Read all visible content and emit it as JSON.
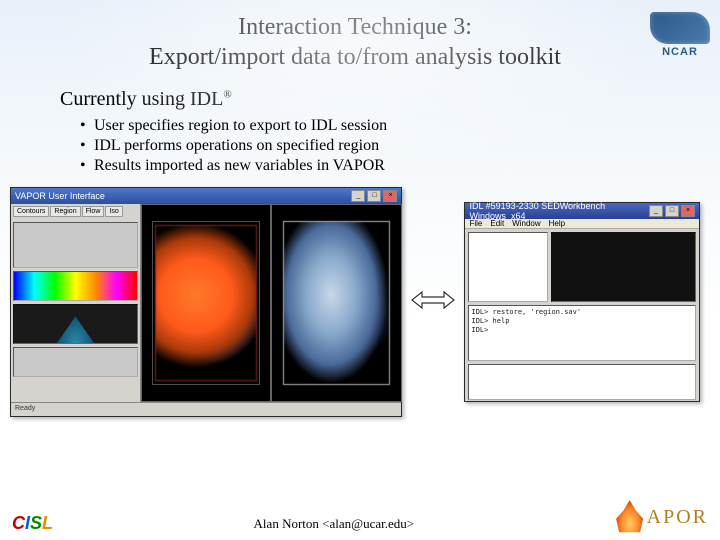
{
  "title": {
    "line1": "Interaction Technique 3:",
    "line2": "Export/import data to/from analysis toolkit"
  },
  "subheading": "Currently using IDL",
  "subheading_mark": "®",
  "bullets": [
    "User specifies region to export to IDL session",
    "IDL performs operations on specified region",
    "Results imported as new variables in VAPOR"
  ],
  "vapor_app": {
    "title": "VAPOR User Interface",
    "tabs": [
      "Contours",
      "Region",
      "Flow",
      "Iso"
    ],
    "status": "Ready"
  },
  "idl_app": {
    "title": "IDL #59193-2330  SEDWorkbench Windows_x64",
    "menu": [
      "File",
      "Edit",
      "Window",
      "Help"
    ],
    "console_prompt": "IDL>",
    "console_lines": [
      "IDL> restore, 'region.sav'",
      "IDL> help",
      "IDL> "
    ]
  },
  "footer": {
    "author": "Alan Norton <alan@ucar.edu>"
  },
  "logos": {
    "ncar": "NCAR",
    "cisl": "CISL",
    "vapor": "APOR"
  }
}
